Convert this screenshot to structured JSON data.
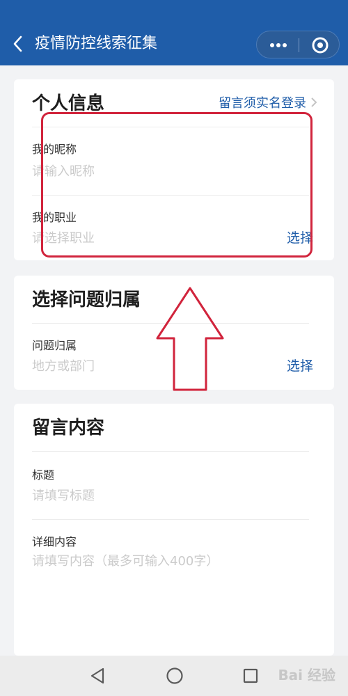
{
  "header": {
    "title": "疫情防控线索征集",
    "back_icon": "back-arrow-icon",
    "more_icon": "more-dots-icon",
    "close_icon": "close-circle-icon"
  },
  "personal_info": {
    "title": "个人信息",
    "login_link": "留言须实名登录",
    "nickname_label": "我的昵称",
    "nickname_placeholder": "请输入昵称",
    "occupation_label": "我的职业",
    "occupation_placeholder": "请选择职业",
    "occupation_select": "选择"
  },
  "problem_section": {
    "title": "选择问题归属",
    "label": "问题归属",
    "placeholder": "地方或部门",
    "select": "选择"
  },
  "message_section": {
    "title": "留言内容",
    "title_label": "标题",
    "title_placeholder": "请填写标题",
    "detail_label": "详细内容",
    "detail_placeholder": "请填写内容（最多可输入400字）"
  },
  "annotations": {
    "highlight_color": "#d1243c"
  },
  "watermark": "Bai 经验",
  "colors": {
    "header_bg": "#1f5da9",
    "accent": "#1f5da9"
  }
}
